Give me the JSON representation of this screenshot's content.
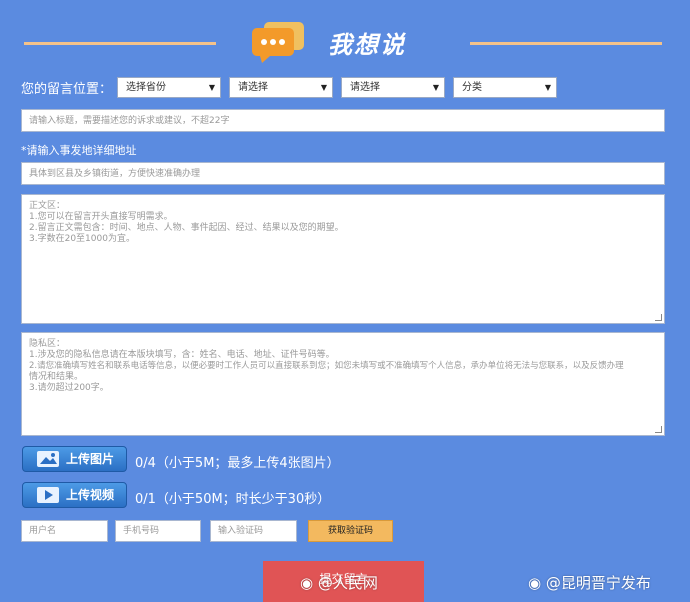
{
  "header": {
    "title": "我想说",
    "line_color": "#f4c28a",
    "icon": "chat-bubble-icon"
  },
  "location": {
    "label": "您的留言位置：",
    "selects": [
      {
        "value": "选择省份"
      },
      {
        "value": "请选择"
      },
      {
        "value": "请选择"
      },
      {
        "value": "分类"
      }
    ]
  },
  "title_input": {
    "placeholder": "请输入标题，需要描述您的诉求或建议，不超22字"
  },
  "address": {
    "required_label": "*请输入事发地详细地址",
    "placeholder": "具体到区县及乡镇街道，方便快速准确办理"
  },
  "body_textarea": {
    "lines": [
      "正文区：",
      "1.您可以在留言开头直接写明需求。",
      "2.留言正文需包含：时间、地点、人物、事件起因、经过、结果以及您的期望。",
      "3.字数在20至1000为宜。"
    ]
  },
  "privacy_textarea": {
    "lines": [
      "隐私区：",
      "1.涉及您的隐私信息请在本版块填写，含：姓名、电话、地址、证件号码等。",
      "2.请您准确填写姓名和联系电话等信息，以便必要时工作人员可以直接联系到您；如您未填写或不准确填写个人信息，承办单位将无法与您联系，以及反馈办理",
      "情况和结果。",
      "3.请勿超过200字。"
    ]
  },
  "upload_image": {
    "label": "上传图片",
    "info": "0/4（小于5M；最多上传4张图片）"
  },
  "upload_video": {
    "label": "上传视频",
    "info": "0/1（小于50M；时长少于30秒）"
  },
  "contact": {
    "username_placeholder": "用户名",
    "phone_placeholder": "手机号码",
    "code_placeholder": "输入验证码",
    "get_code_label": "获取验证码"
  },
  "submit_label": "提交留言",
  "watermarks": {
    "left": "@人民网",
    "right": "@昆明晋宁发布"
  },
  "colors": {
    "background": "#5b8be0",
    "submit": "#e05455",
    "get_code": "#f3b95f",
    "upload_button": "#2b6fc4"
  }
}
